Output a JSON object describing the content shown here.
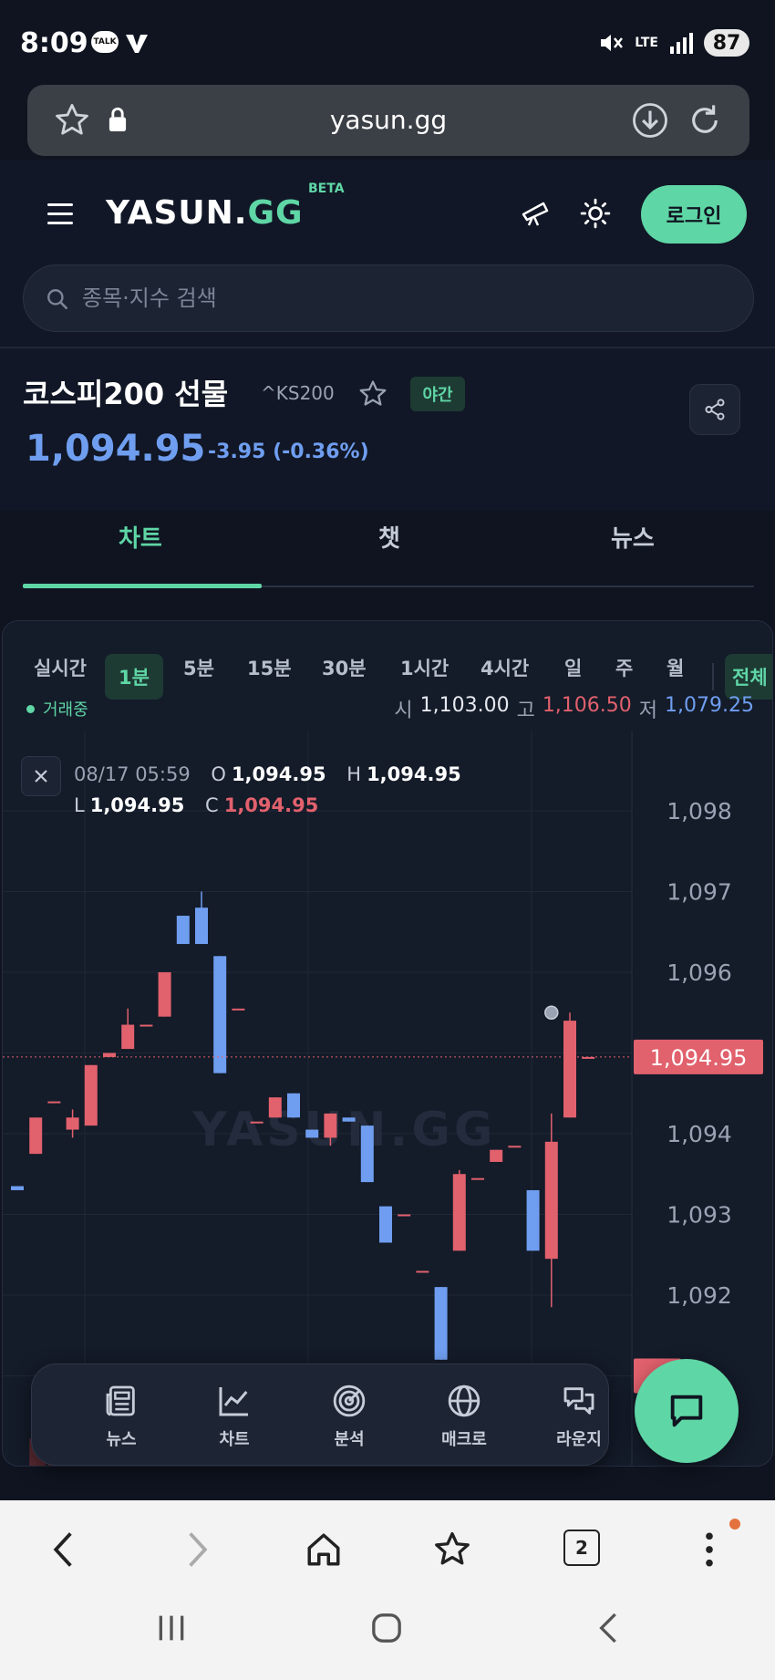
{
  "status_bar": {
    "time": "8:09",
    "battery": "87",
    "network": "LTE",
    "talk_badge": "TALK"
  },
  "browser": {
    "url": "yasun.gg",
    "tab_count": "2"
  },
  "header": {
    "logo_main": "YASUN.",
    "logo_accent": "GG",
    "beta": "BETA",
    "login_label": "로그인",
    "search_placeholder": "종목·지수 검색"
  },
  "stock": {
    "name": "코스피200 선물",
    "ticker": "^KS200",
    "session_badge": "야간",
    "price": "1,094.95",
    "change": "-3.95 (-0.36%)"
  },
  "tabs": [
    {
      "label": "차트",
      "active": true
    },
    {
      "label": "챗",
      "active": false
    },
    {
      "label": "뉴스",
      "active": false
    }
  ],
  "intervals": [
    "실시간",
    "1분",
    "5분",
    "15분",
    "30분",
    "1시간",
    "4시간",
    "일",
    "주",
    "월"
  ],
  "interval_active": "1분",
  "interval_all": "전체",
  "trading_status": "거래중",
  "day_stats": {
    "open_label": "시",
    "open": "1,103.00",
    "high_label": "고",
    "high": "1,106.50",
    "low_label": "저",
    "low": "1,079.25"
  },
  "crosshair": {
    "datetime": "08/17 05:59",
    "o_label": "O",
    "o": "1,094.95",
    "h_label": "H",
    "h": "1,094.95",
    "l_label": "L",
    "l": "1,094.95",
    "c_label": "C",
    "c": "1,094.95"
  },
  "chart": {
    "watermark": "YASUN.GG",
    "y_ticks": [
      "1,098",
      "1,097",
      "1,096",
      "1,094",
      "1,093",
      "1,092"
    ],
    "last_price_label": "1,094.95",
    "colors": {
      "up": "#e1616d",
      "down": "#6f9ef0",
      "accent": "#5fd6a6",
      "bg": "#141b29"
    }
  },
  "chart_data": {
    "type": "candlestick",
    "y_ticks": [
      1092,
      1093,
      1094,
      1095,
      1096,
      1097,
      1098
    ],
    "last": 1094.95,
    "candles": [
      {
        "o": 1093.35,
        "h": 1093.35,
        "l": 1093.3,
        "c": 1093.3
      },
      {
        "o": 1093.75,
        "h": 1094.2,
        "l": 1093.75,
        "c": 1094.2
      },
      {
        "o": 1094.4,
        "h": 1094.4,
        "l": 1094.4,
        "c": 1094.4
      },
      {
        "o": 1094.05,
        "h": 1094.3,
        "l": 1093.95,
        "c": 1094.2
      },
      {
        "o": 1094.1,
        "h": 1094.85,
        "l": 1094.1,
        "c": 1094.85
      },
      {
        "o": 1094.95,
        "h": 1095.0,
        "l": 1094.95,
        "c": 1095.0
      },
      {
        "o": 1095.05,
        "h": 1095.55,
        "l": 1095.05,
        "c": 1095.35
      },
      {
        "o": 1095.35,
        "h": 1095.35,
        "l": 1095.35,
        "c": 1095.35
      },
      {
        "o": 1095.45,
        "h": 1096.0,
        "l": 1095.45,
        "c": 1096.0
      },
      {
        "o": 1096.7,
        "h": 1096.7,
        "l": 1096.35,
        "c": 1096.35
      },
      {
        "o": 1096.8,
        "h": 1097.0,
        "l": 1096.35,
        "c": 1096.35
      },
      {
        "o": 1096.2,
        "h": 1096.2,
        "l": 1094.75,
        "c": 1094.75
      },
      {
        "o": 1095.55,
        "h": 1095.55,
        "l": 1095.55,
        "c": 1095.55
      },
      {
        "o": 1094.15,
        "h": 1094.15,
        "l": 1094.15,
        "c": 1094.15
      },
      {
        "o": 1094.2,
        "h": 1094.45,
        "l": 1094.2,
        "c": 1094.45
      },
      {
        "o": 1094.5,
        "h": 1094.5,
        "l": 1094.2,
        "c": 1094.2
      },
      {
        "o": 1094.05,
        "h": 1094.05,
        "l": 1093.95,
        "c": 1093.95
      },
      {
        "o": 1093.95,
        "h": 1094.25,
        "l": 1093.85,
        "c": 1094.25
      },
      {
        "o": 1094.2,
        "h": 1094.2,
        "l": 1094.15,
        "c": 1094.15
      },
      {
        "o": 1094.1,
        "h": 1094.1,
        "l": 1093.4,
        "c": 1093.4
      },
      {
        "o": 1093.1,
        "h": 1093.1,
        "l": 1092.65,
        "c": 1092.65
      },
      {
        "o": 1093.0,
        "h": 1093.0,
        "l": 1093.0,
        "c": 1093.0
      },
      {
        "o": 1092.3,
        "h": 1092.3,
        "l": 1092.3,
        "c": 1092.3
      },
      {
        "o": 1092.1,
        "h": 1092.1,
        "l": 1091.2,
        "c": 1091.2
      },
      {
        "o": 1092.55,
        "h": 1093.55,
        "l": 1092.55,
        "c": 1093.5
      },
      {
        "o": 1093.45,
        "h": 1093.45,
        "l": 1093.45,
        "c": 1093.45
      },
      {
        "o": 1093.65,
        "h": 1093.8,
        "l": 1093.65,
        "c": 1093.8
      },
      {
        "o": 1093.85,
        "h": 1093.85,
        "l": 1093.85,
        "c": 1093.85
      },
      {
        "o": 1093.3,
        "h": 1093.3,
        "l": 1092.55,
        "c": 1092.55
      },
      {
        "o": 1092.45,
        "h": 1094.25,
        "l": 1091.85,
        "c": 1093.9
      },
      {
        "o": 1094.2,
        "h": 1095.5,
        "l": 1094.2,
        "c": 1095.4
      },
      {
        "o": 1094.95,
        "h": 1094.95,
        "l": 1094.95,
        "c": 1094.95
      }
    ],
    "volumes": [
      0,
      0.35,
      0.6,
      0.25,
      0.35,
      0,
      0,
      0,
      0,
      0,
      0,
      0,
      0,
      0,
      0,
      0,
      0.15,
      0,
      0,
      0,
      0,
      0,
      0,
      0,
      0.2,
      0,
      0,
      0,
      0,
      0.55,
      0.8,
      0
    ]
  },
  "bottom_nav": [
    {
      "label": "뉴스",
      "icon": "news-icon"
    },
    {
      "label": "차트",
      "icon": "chart-icon"
    },
    {
      "label": "분석",
      "icon": "radar-icon"
    },
    {
      "label": "매크로",
      "icon": "globe-icon"
    },
    {
      "label": "라운지",
      "icon": "chat-bubbles-icon"
    }
  ]
}
